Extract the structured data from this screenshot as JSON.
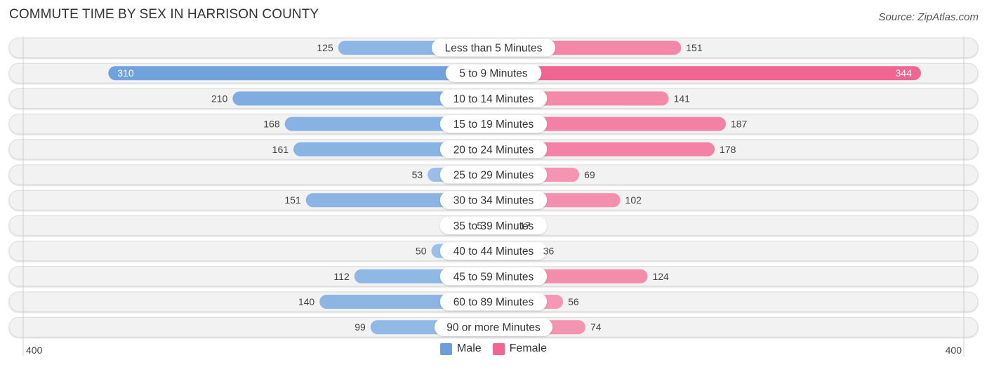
{
  "header": {
    "title": "COMMUTE TIME BY SEX IN HARRISON COUNTY",
    "source": "Source: ZipAtlas.com"
  },
  "colors": {
    "male": "#6a9fdb",
    "male_light": "#a9c8ec",
    "female": "#f06592",
    "female_light": "#f7a8c0",
    "track": "#f2f2f2"
  },
  "legend": {
    "male_label": "Male",
    "female_label": "Female"
  },
  "axis": {
    "left_label": "400",
    "right_label": "400"
  },
  "chart_data": {
    "type": "bar",
    "orientation": "horizontal-diverging",
    "title": "COMMUTE TIME BY SEX IN HARRISON COUNTY",
    "xlabel": "",
    "ylabel": "",
    "xlim": [
      -400,
      400
    ],
    "legend_position": "bottom-center",
    "categories": [
      "Less than 5 Minutes",
      "5 to 9 Minutes",
      "10 to 14 Minutes",
      "15 to 19 Minutes",
      "20 to 24 Minutes",
      "25 to 29 Minutes",
      "30 to 34 Minutes",
      "35 to 39 Minutes",
      "40 to 44 Minutes",
      "45 to 59 Minutes",
      "60 to 89 Minutes",
      "90 or more Minutes"
    ],
    "series": [
      {
        "name": "Male",
        "values": [
          125,
          310,
          210,
          168,
          161,
          53,
          151,
          5,
          50,
          112,
          140,
          99
        ]
      },
      {
        "name": "Female",
        "values": [
          151,
          344,
          141,
          187,
          178,
          69,
          102,
          17,
          36,
          124,
          56,
          74
        ]
      }
    ]
  }
}
